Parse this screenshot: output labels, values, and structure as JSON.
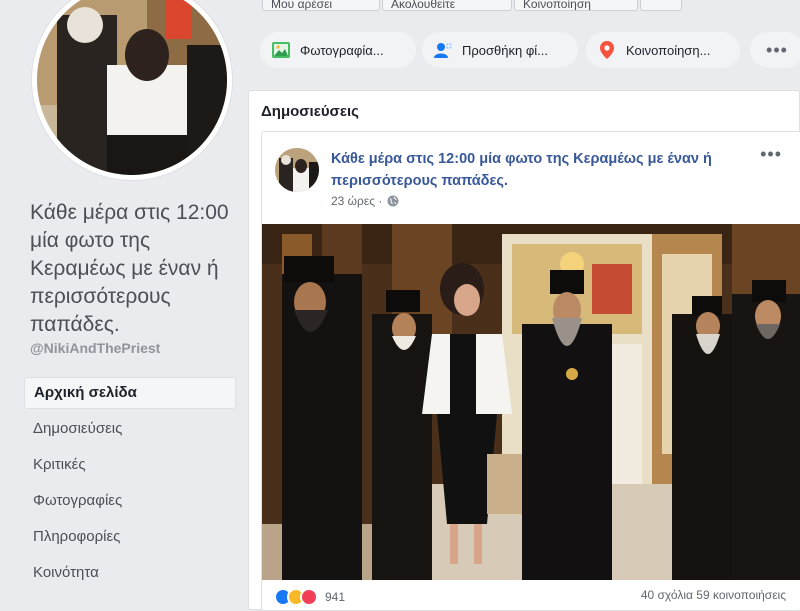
{
  "page": {
    "name": "Κάθε μέρα στις 12:00 μία φωτο της Κεραμέως με έναν ή περισσότερους παπάδες.",
    "handle": "@NikiAndThePriest"
  },
  "sidebar": {
    "items": [
      {
        "label": "Αρχική σελίδα",
        "active": true
      },
      {
        "label": "Δημοσιεύσεις"
      },
      {
        "label": "Κριτικές"
      },
      {
        "label": "Φωτογραφίες"
      },
      {
        "label": "Πληροφορίες"
      },
      {
        "label": "Κοινότητα"
      }
    ]
  },
  "top_actions": {
    "btn1": "Μου αρέσει",
    "btn2": "Ακολουθείτε",
    "btn3": "Κοινοποίηση"
  },
  "composer": {
    "photo": "Φωτογραφία...",
    "tag": "Προσθήκη φί...",
    "share": "Κοινοποίηση...",
    "more": "•••"
  },
  "posts_section": {
    "title": "Δημοσιεύσεις"
  },
  "post": {
    "text": "Κάθε μέρα στις 12:00 μία φωτο της Κεραμέως με έναν ή περισσότερους παπάδες.",
    "time": "23 ώρες ·",
    "more": "•••",
    "reaction_count": "941",
    "stats": "40 σχόλια  59 κοινοποιήσεις"
  },
  "colors": {
    "link": "#385898",
    "background": "#e9ebee",
    "like": "#1877f2",
    "haha": "#f7b928",
    "love": "#f33e58"
  }
}
